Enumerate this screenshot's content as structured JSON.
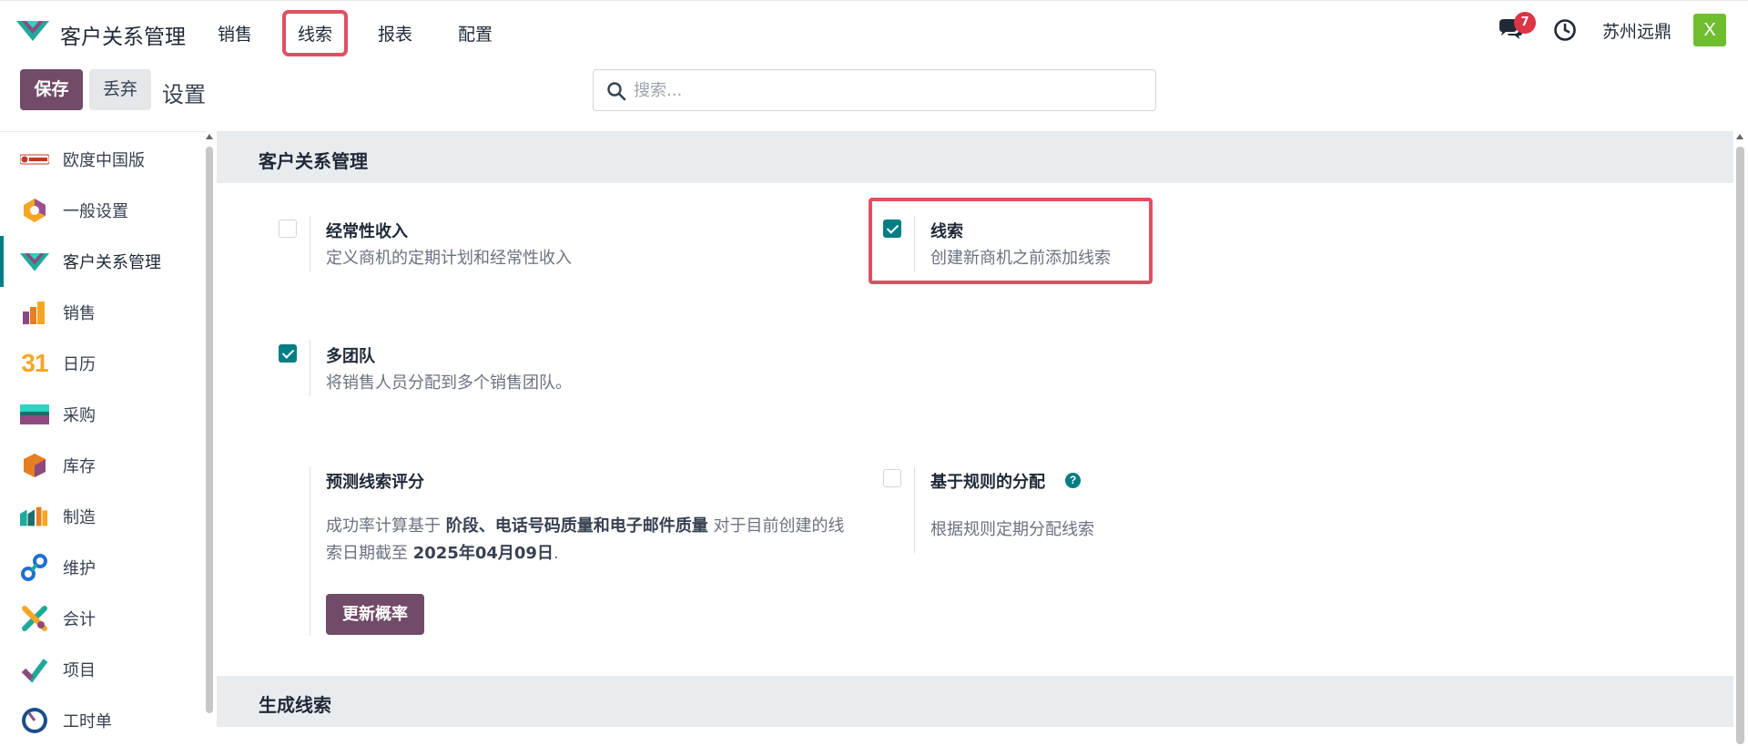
{
  "app": {
    "title": "客户关系管理",
    "logo_icon": "crm-logo-icon",
    "accent_color": "#714b67",
    "teal_color": "#017e84",
    "highlight_color": "#e04f62"
  },
  "nav": {
    "menu": [
      {
        "label": "销售",
        "active": false
      },
      {
        "label": "线索",
        "active": true
      },
      {
        "label": "报表",
        "active": false
      },
      {
        "label": "配置",
        "active": false
      }
    ],
    "notifications": "7",
    "company": "苏州远鼎",
    "avatar_letter": "X"
  },
  "control": {
    "save_label": "保存",
    "discard_label": "丢弃",
    "page_title": "设置",
    "search_placeholder": "搜索..."
  },
  "sidebar": {
    "items": [
      {
        "label": "欧度中国版",
        "icon": "odoo-china-icon",
        "active": false
      },
      {
        "label": "一般设置",
        "icon": "general-settings-icon",
        "active": false
      },
      {
        "label": "客户关系管理",
        "icon": "crm-icon",
        "active": true
      },
      {
        "label": "销售",
        "icon": "sales-icon",
        "active": false
      },
      {
        "label": "日历",
        "icon": "calendar-icon",
        "active": false
      },
      {
        "label": "采购",
        "icon": "purchase-icon",
        "active": false
      },
      {
        "label": "库存",
        "icon": "inventory-icon",
        "active": false
      },
      {
        "label": "制造",
        "icon": "manufacturing-icon",
        "active": false
      },
      {
        "label": "维护",
        "icon": "maintenance-icon",
        "active": false
      },
      {
        "label": "会计",
        "icon": "accounting-icon",
        "active": false
      },
      {
        "label": "项目",
        "icon": "project-icon",
        "active": false
      },
      {
        "label": "工时单",
        "icon": "timesheet-icon",
        "active": false
      }
    ],
    "calendar_number": "31"
  },
  "main": {
    "section1": "客户关系管理",
    "section2": "生成线索",
    "settings": {
      "recurring": {
        "title": "经常性收入",
        "desc": "定义商机的定期计划和经常性收入",
        "checked": false
      },
      "leads": {
        "title": "线索",
        "desc": "创建新商机之前添加线索",
        "checked": true
      },
      "multi_team": {
        "title": "多团队",
        "desc": "将销售人员分配到多个销售团队。",
        "checked": true
      },
      "predictive": {
        "title": "预测线索评分",
        "para_1": "成功率计算基于 ",
        "para_bold_1": "阶段、电话号码质量和电子邮件质量",
        "para_2": " 对于目前创建的线索日期截至 ",
        "para_bold_2": "2025年04月09日",
        "para_3": ".",
        "button": "更新概率"
      },
      "rule_based": {
        "title": "基于规则的分配",
        "desc": "根据规则定期分配线索",
        "checked": false,
        "help": "?"
      }
    }
  }
}
